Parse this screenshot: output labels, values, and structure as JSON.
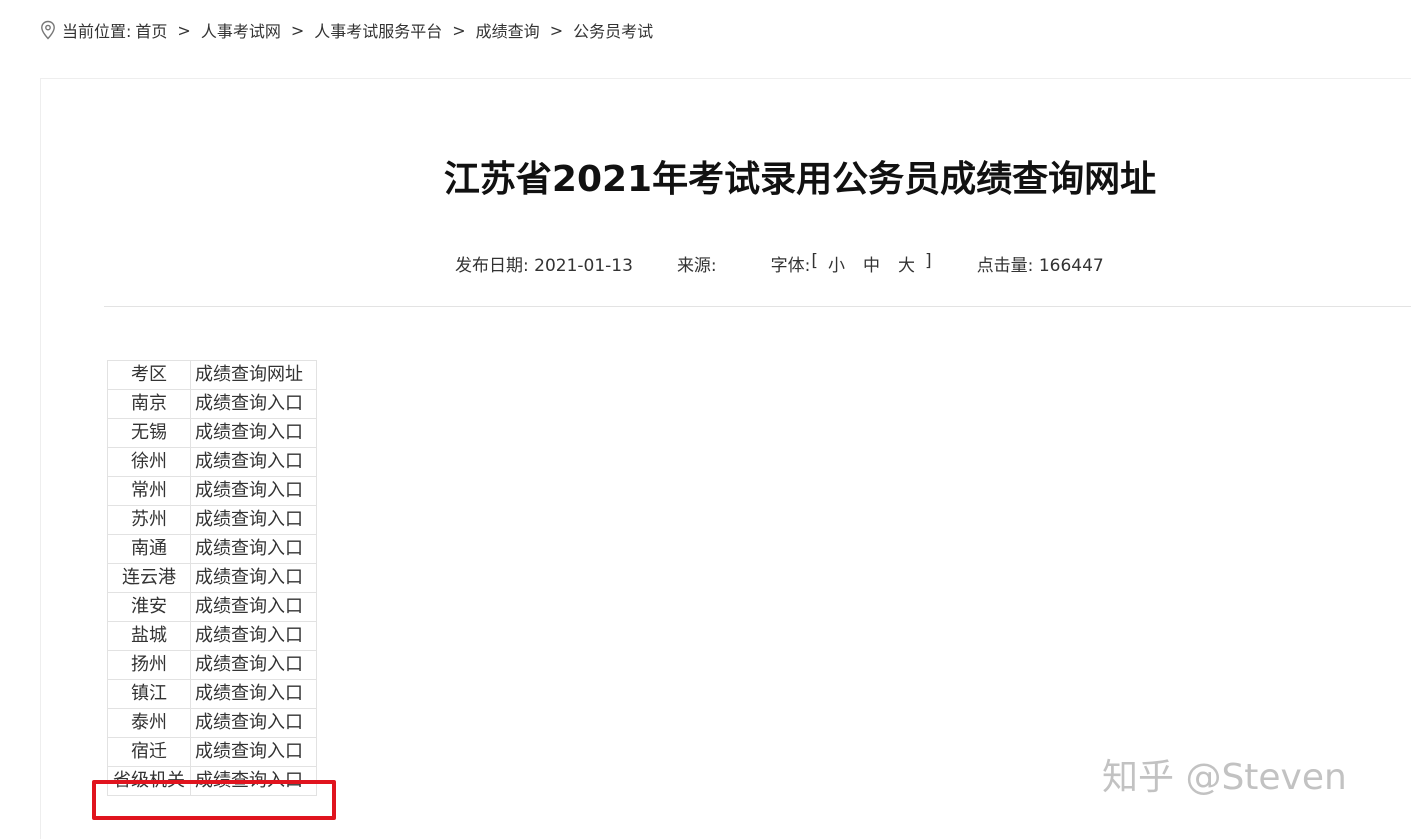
{
  "breadcrumb": {
    "prefix": "当前位置:",
    "items": [
      "首页",
      "人事考试网",
      "人事考试服务平台",
      "成绩查询",
      "公务员考试"
    ],
    "separator": ">"
  },
  "article": {
    "title": "江苏省2021年考试录用公务员成绩查询网址",
    "date_label": "发布日期: 2021-01-13",
    "source_label": "来源:",
    "font_label": "字体:",
    "font_open": "[",
    "font_options": [
      "小",
      "中",
      "大"
    ],
    "font_close": "]",
    "hits_label": "点击量: 166447"
  },
  "table": {
    "headers": [
      "考区",
      "成绩查询网址"
    ],
    "rows": [
      [
        "南京",
        "成绩查询入口"
      ],
      [
        "无锡",
        "成绩查询入口"
      ],
      [
        "徐州",
        "成绩查询入口"
      ],
      [
        "常州",
        "成绩查询入口"
      ],
      [
        "苏州",
        "成绩查询入口"
      ],
      [
        "南通",
        "成绩查询入口"
      ],
      [
        "连云港",
        "成绩查询入口"
      ],
      [
        "淮安",
        "成绩查询入口"
      ],
      [
        "盐城",
        "成绩查询入口"
      ],
      [
        "扬州",
        "成绩查询入口"
      ],
      [
        "镇江",
        "成绩查询入口"
      ],
      [
        "泰州",
        "成绩查询入口"
      ],
      [
        "宿迁",
        "成绩查询入口"
      ],
      [
        "省级机关",
        "成绩查询入口"
      ]
    ]
  },
  "highlight_color": "#e0141e",
  "watermark": "知乎 @Steven"
}
